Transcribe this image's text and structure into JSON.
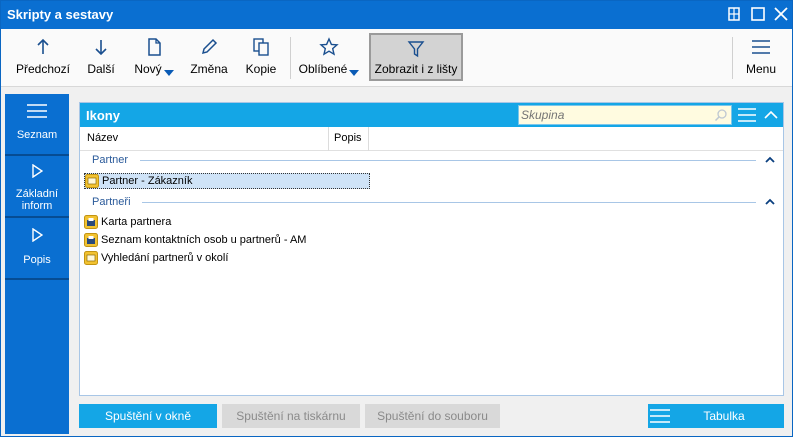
{
  "window": {
    "title": "Skripty a sestavy"
  },
  "toolbar": {
    "previous": "Předchozí",
    "next": "Další",
    "new": "Nový",
    "change": "Změna",
    "copy": "Kopie",
    "favorites": "Oblíbené",
    "show_from_bar": "Zobrazit i z lišty",
    "menu": "Menu"
  },
  "leftnav": {
    "items": [
      {
        "label": "Seznam"
      },
      {
        "label1": "Základní",
        "label2": "inform"
      },
      {
        "label": "Popis"
      }
    ]
  },
  "panel": {
    "title": "Ikony",
    "search_placeholder": "Skupina",
    "columns": [
      "Název",
      "Popis"
    ],
    "groups": [
      {
        "name": "Partner",
        "rows": [
          "Partner - Zákazník"
        ]
      },
      {
        "name": "Partneři",
        "rows": [
          "Karta partnera",
          "Seznam kontaktních osob u partnerů - AM",
          "Vyhledání partnerů v okolí"
        ]
      }
    ]
  },
  "footer": {
    "run_window": "Spuštění v okně",
    "run_printer": "Spuštění na tiskárnu",
    "run_file": "Spuštění do souboru",
    "table": "Tabulka"
  }
}
